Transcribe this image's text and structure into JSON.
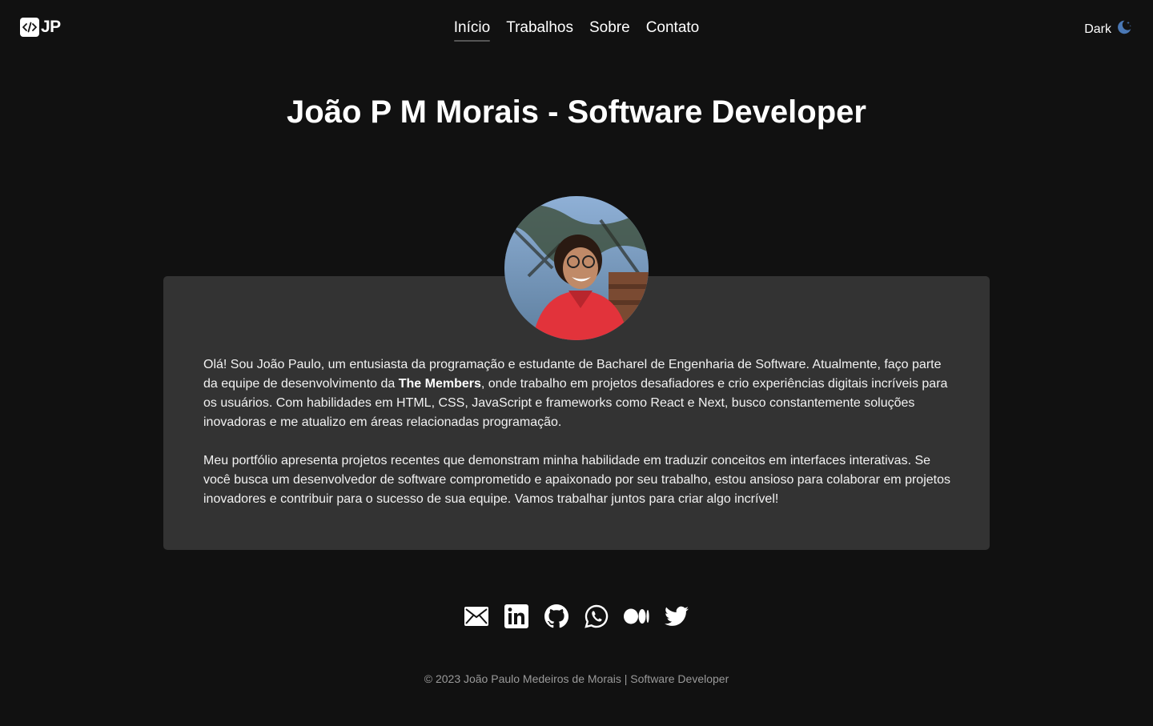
{
  "header": {
    "logo_text": "JP",
    "nav": [
      {
        "label": "Início",
        "active": true
      },
      {
        "label": "Trabalhos",
        "active": false
      },
      {
        "label": "Sobre",
        "active": false
      },
      {
        "label": "Contato",
        "active": false
      }
    ],
    "theme_label": "Dark"
  },
  "main": {
    "title": "João P M Morais - Software Developer",
    "about": {
      "p1_before": "Olá! Sou João Paulo, um entusiasta da programação e estudante de Bacharel de Engenharia de Software. Atualmente, faço parte da equipe de desenvolvimento da ",
      "p1_bold": "The Members",
      "p1_after": ", onde trabalho em projetos desafiadores e crio experiências digitais incríveis para os usuários. Com habilidades em HTML, CSS, JavaScript e frameworks como React e Next, busco constantemente soluções inovadoras e me atualizo em áreas relacionadas programação.",
      "p2": "Meu portfólio apresenta projetos recentes que demonstram minha habilidade em traduzir conceitos em interfaces interativas. Se você busca um desenvolvedor de software comprometido e apaixonado por seu trabalho, estou ansioso para colaborar em projetos inovadores e contribuir para o sucesso de sua equipe. Vamos trabalhar juntos para criar algo incrível!"
    }
  },
  "social": [
    {
      "icon": "email-icon"
    },
    {
      "icon": "linkedin-icon"
    },
    {
      "icon": "github-icon"
    },
    {
      "icon": "whatsapp-icon"
    },
    {
      "icon": "medium-icon"
    },
    {
      "icon": "twitter-icon"
    }
  ],
  "footer": {
    "text": "© 2023 João Paulo Medeiros de Morais | Software Developer"
  },
  "colors": {
    "background": "#111111",
    "card": "#333333",
    "text": "#ffffff",
    "footer_text": "#9a9a9a",
    "moon_accent": "#4a78b5"
  }
}
